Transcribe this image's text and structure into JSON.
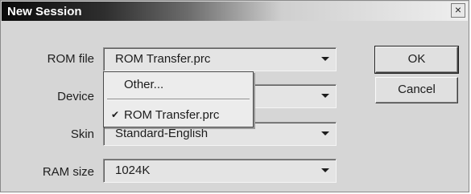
{
  "window": {
    "title": "New Session"
  },
  "fields": {
    "rom_file": {
      "label": "ROM file",
      "value": "ROM Transfer.prc"
    },
    "device": {
      "label": "Device",
      "value": ""
    },
    "skin": {
      "label": "Skin",
      "value": "Standard-English"
    },
    "ram_size": {
      "label": "RAM size",
      "value": "1024K"
    }
  },
  "rom_dropdown": {
    "items": [
      {
        "label": "Other...",
        "checked": false
      },
      {
        "label": "ROM Transfer.prc",
        "checked": true
      }
    ]
  },
  "buttons": {
    "ok": "OK",
    "cancel": "Cancel",
    "close": "×"
  }
}
